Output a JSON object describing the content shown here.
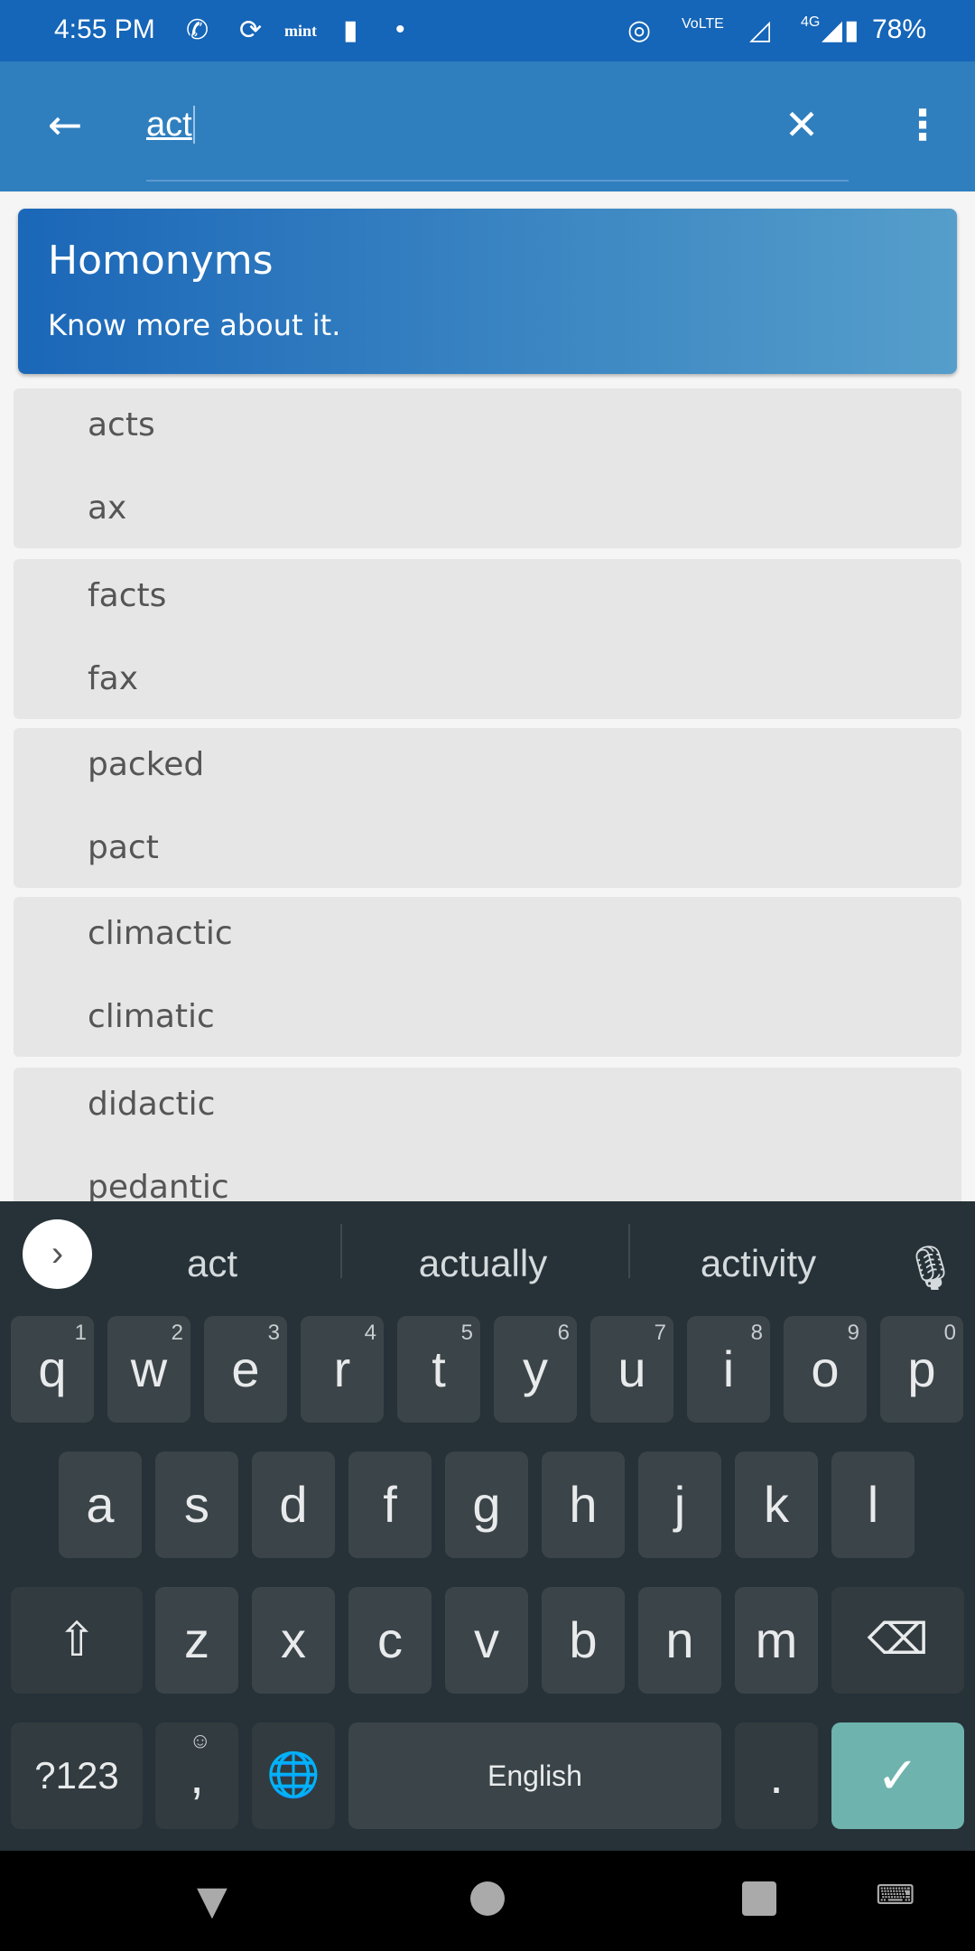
{
  "status": {
    "time": "4:55 PM",
    "battery": "78%",
    "network": "4G",
    "notif_text": "mint"
  },
  "appbar": {
    "query": "act",
    "back_icon": "arrow-left-icon",
    "clear_icon": "close-icon",
    "menu_icon": "more-vert-icon"
  },
  "banner": {
    "title": "Homonyms",
    "subtitle": "Know more about it."
  },
  "groups": [
    [
      "acts",
      "ax"
    ],
    [
      "facts",
      "fax"
    ],
    [
      "packed",
      "pact"
    ],
    [
      "climactic",
      "climatic"
    ],
    [
      "didactic",
      "pedantic"
    ]
  ],
  "keyboard": {
    "suggestions": [
      "act",
      "actually",
      "activity"
    ],
    "row1": [
      [
        "q",
        "1"
      ],
      [
        "w",
        "2"
      ],
      [
        "e",
        "3"
      ],
      [
        "r",
        "4"
      ],
      [
        "t",
        "5"
      ],
      [
        "y",
        "6"
      ],
      [
        "u",
        "7"
      ],
      [
        "i",
        "8"
      ],
      [
        "o",
        "9"
      ],
      [
        "p",
        "0"
      ]
    ],
    "row2": [
      "a",
      "s",
      "d",
      "f",
      "g",
      "h",
      "j",
      "k",
      "l"
    ],
    "row3": [
      "z",
      "x",
      "c",
      "v",
      "b",
      "n",
      "m"
    ],
    "symbols": "?123",
    "comma": ",",
    "space": "English",
    "period": ".",
    "enter_color": "#6fb3ae"
  }
}
